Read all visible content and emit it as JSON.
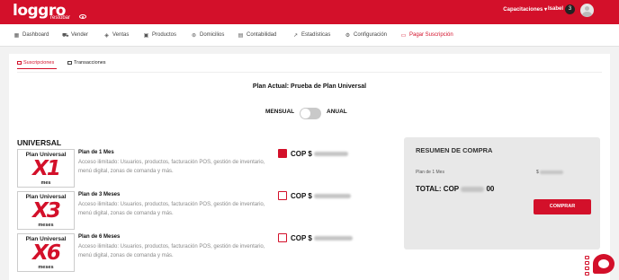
{
  "brand": {
    "logo_text": "loggro",
    "logo_sub": "restobar"
  },
  "header": {
    "nav_label": "Capacitaciones",
    "nav_caret": "▾",
    "user_name": "Isabel",
    "badge_count": "3"
  },
  "menu": [
    {
      "label": "Dashboard",
      "icon": "grid-icon",
      "glyph": "▦"
    },
    {
      "label": "Vender",
      "icon": "cart-icon",
      "glyph": "⛟"
    },
    {
      "label": "Ventas",
      "icon": "tag-icon",
      "glyph": "◈"
    },
    {
      "label": "Productos",
      "icon": "box-icon",
      "glyph": "▣"
    },
    {
      "label": "Domicilios",
      "icon": "motorbike-icon",
      "glyph": "⊛"
    },
    {
      "label": "Contabilidad",
      "icon": "ledger-icon",
      "glyph": "▤"
    },
    {
      "label": "Estadísticas",
      "icon": "trend-icon",
      "glyph": "↗"
    },
    {
      "label": "Configuración",
      "icon": "gear-icon",
      "glyph": "⚙"
    },
    {
      "label": "Pagar Suscripción",
      "icon": "card-icon",
      "glyph": "▭"
    }
  ],
  "tabs": {
    "subscriptions": "Suscripciones",
    "transactions": "Transacciones"
  },
  "plan_title": "Plan Actual: Prueba de Plan Universal",
  "billing": {
    "monthly": "MENSUAL",
    "annual": "ANUAL",
    "annual_selected": false
  },
  "section_title": "UNIVERSAL",
  "plans": [
    {
      "img_top": "Plan Universal",
      "img_big": "X1",
      "img_bottom": "mes",
      "name": "Plan de 1 Mes",
      "desc": "Acceso ilimitado: Usuarios, productos, facturación POS, gestión de inventario, menú digital, zonas de comanda y más.",
      "price_prefix": "COP $",
      "selected": true
    },
    {
      "img_top": "Plan Universal",
      "img_big": "X3",
      "img_bottom": "meses",
      "name": "Plan de 3 Meses",
      "desc": "Acceso ilimitado: Usuarios, productos, facturación POS, gestión de inventario, menú digital, zonas de comanda y más.",
      "price_prefix": "COP $",
      "selected": false
    },
    {
      "img_top": "Plan Universal",
      "img_big": "X6",
      "img_bottom": "meses",
      "name": "Plan de 6 Meses",
      "desc": "Acceso ilimitado: Usuarios, productos, facturación POS, gestión de inventario, menú digital, zonas de comanda y más.",
      "price_prefix": "COP $",
      "selected": false
    }
  ],
  "summary": {
    "title": "RESUMEN DE COMPRA",
    "item": "Plan de 1 Mes",
    "item_price_prefix": "$",
    "total_prefix": "TOTAL: COP",
    "total_suffix": "00",
    "button": "COMPRAR"
  },
  "colors": {
    "accent": "#d3102a"
  }
}
